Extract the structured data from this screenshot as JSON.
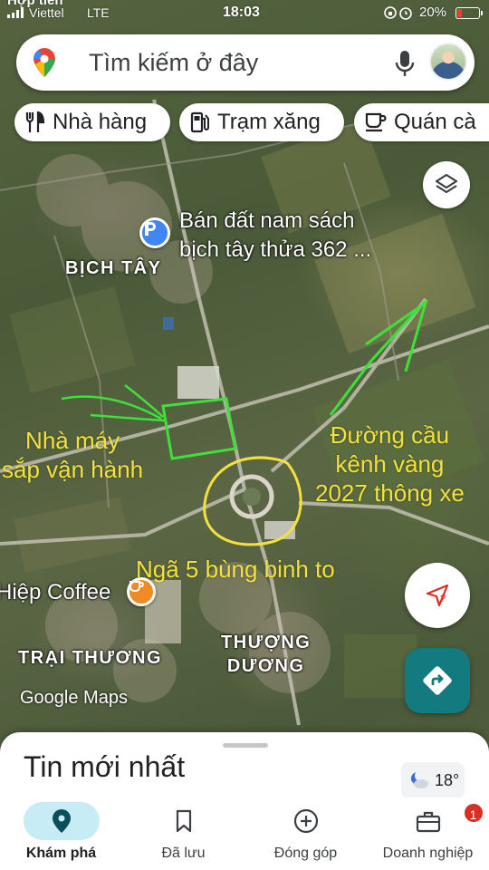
{
  "status_bar": {
    "carrier_top": "Hợp tiến",
    "carrier": "Viettel",
    "network": "LTE",
    "time": "18:03",
    "battery_percent": "20%",
    "battery_level": 0.2,
    "battery_color": "#ff3b30"
  },
  "search": {
    "placeholder": "Tìm kiếm ở đây",
    "logo_icon": "google-maps-pin-icon",
    "mic_icon": "microphone-icon"
  },
  "chips": [
    {
      "label": "Nhà hàng",
      "icon": "fork-knife-icon"
    },
    {
      "label": "Trạm xăng",
      "icon": "gas-pump-icon"
    },
    {
      "label": "Quán cà",
      "icon": "coffee-cup-icon"
    }
  ],
  "map": {
    "place_pin_label": "Bán đất nam sách\nbịch tây thửa 362 ...",
    "area_bich_tay": "BỊCH TÂY",
    "area_trai_thuong": "TRẠI THƯƠNG",
    "area_thuong_duong": "THƯỢNG\nDƯƠNG",
    "coffee_label": "Hiệp Coffee",
    "annotation_factory": "Nhà máy\nsắp vận hành",
    "annotation_road": "Đường cầu\nkênh vàng\n2027 thông xe",
    "annotation_junction": "Ngã 5 bùng binh to",
    "watermark": "Google Maps",
    "accent_colors": {
      "annotation_yellow": "#f3e23c",
      "annotation_green": "#3fe03a",
      "poi_blue": "#4285f4",
      "poi_orange": "#f08a24"
    }
  },
  "sheet": {
    "title": "Tin mới nhất",
    "weather_temp": "18°"
  },
  "nav": {
    "items": [
      {
        "label": "Khám phá",
        "icon": "explore-pin-icon",
        "active": true
      },
      {
        "label": "Đã lưu",
        "icon": "bookmark-icon",
        "active": false
      },
      {
        "label": "Đóng góp",
        "icon": "add-circle-icon",
        "active": false
      },
      {
        "label": "Doanh nghiệp",
        "icon": "business-icon",
        "active": false,
        "badge": "1"
      }
    ]
  }
}
